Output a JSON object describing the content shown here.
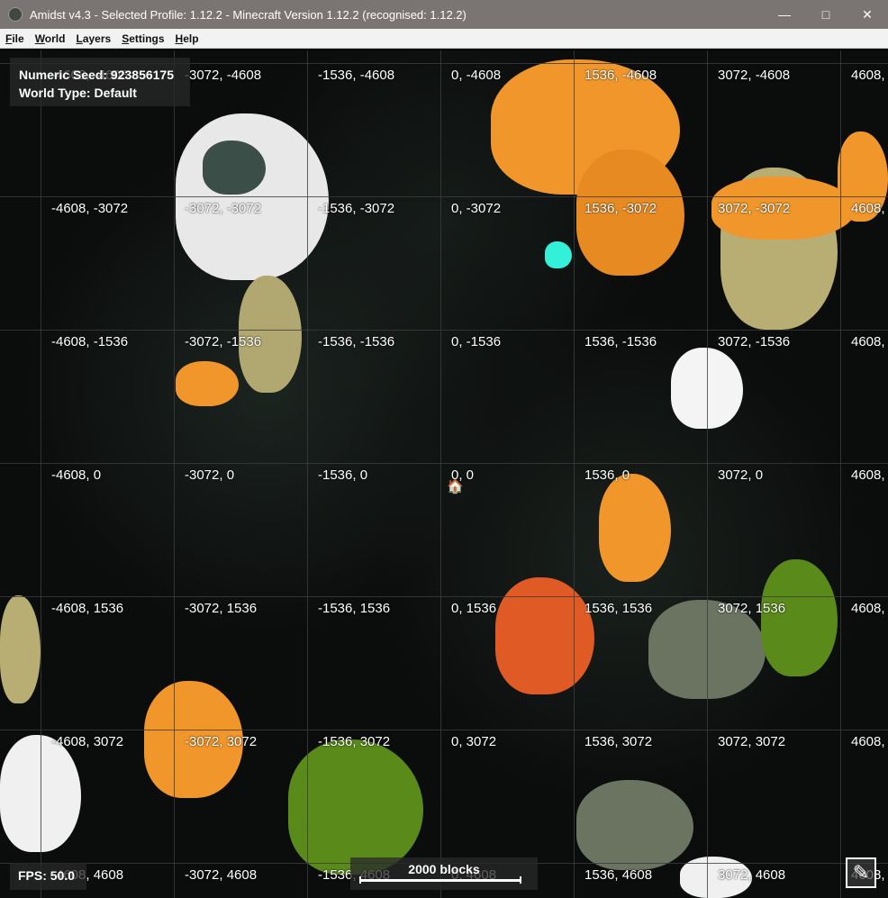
{
  "window": {
    "title": "Amidst v4.3 - Selected Profile: 1.12.2 - Minecraft Version 1.12.2 (recognised: 1.12.2)",
    "controls": [
      "minimize-icon",
      "maximize-icon",
      "close-icon"
    ]
  },
  "menu": [
    {
      "key": "F",
      "rest": "ile"
    },
    {
      "key": "W",
      "rest": "orld"
    },
    {
      "key": "L",
      "rest": "ayers"
    },
    {
      "key": "S",
      "rest": "ettings"
    },
    {
      "key": "H",
      "rest": "elp"
    }
  ],
  "info": {
    "seed": "Numeric Seed: 923856175",
    "world_type": "World Type: Default"
  },
  "fps": "FPS: 50.0",
  "scale": "2000 blocks",
  "grid_x": [
    "-4608",
    "-3072",
    "-1536",
    "0",
    "1536",
    "3072",
    "4608"
  ],
  "grid_y": [
    "-4608",
    "-3072",
    "-1536",
    "0",
    "1536",
    "3072",
    "4608"
  ],
  "spawn_icon": "house-icon",
  "edit_icon": "pencil-icon"
}
